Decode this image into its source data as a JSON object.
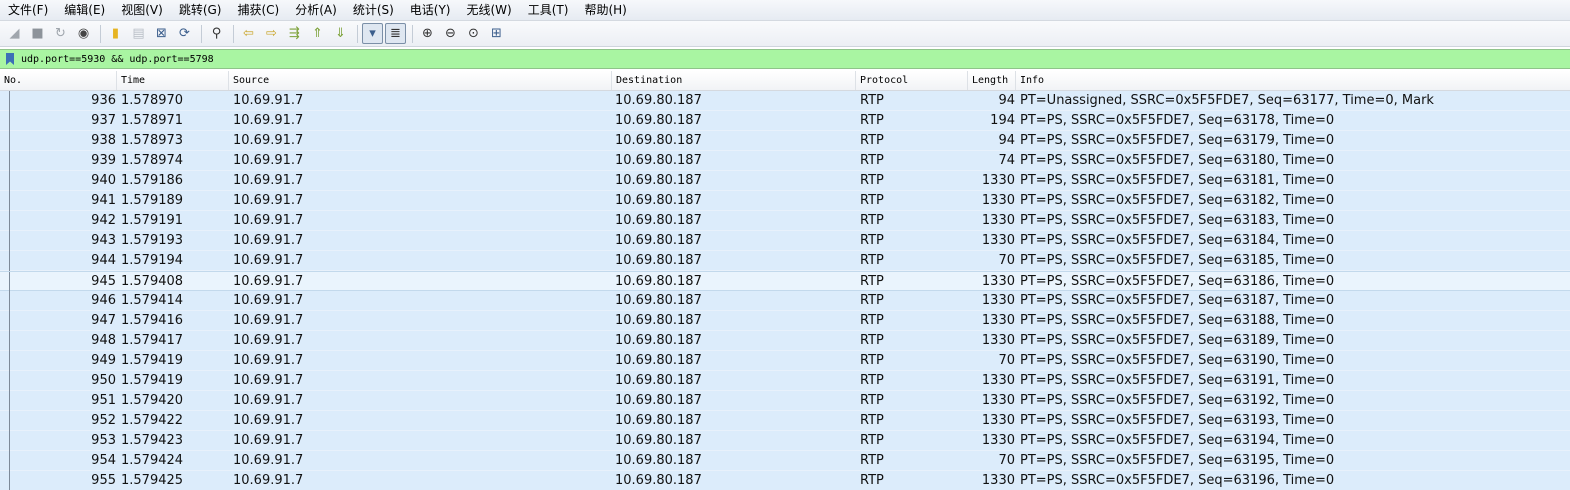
{
  "menu": [
    "文件(F)",
    "编辑(E)",
    "视图(V)",
    "跳转(G)",
    "捕获(C)",
    "分析(A)",
    "统计(S)",
    "电话(Y)",
    "无线(W)",
    "工具(T)",
    "帮助(H)"
  ],
  "toolbar": {
    "buttons": [
      {
        "name": "start-capture-icon",
        "glyph": "◢",
        "color": "#a0a6ad"
      },
      {
        "name": "stop-capture-icon",
        "glyph": "■",
        "color": "#8d939a"
      },
      {
        "name": "restart-capture-icon",
        "glyph": "↻",
        "color": "#a0a6ad"
      },
      {
        "name": "capture-options-icon",
        "glyph": "◉",
        "color": "#444444"
      },
      {
        "name": "open-file-icon",
        "glyph": "▮",
        "color": "#e6b422"
      },
      {
        "name": "save-file-icon",
        "glyph": "▤",
        "color": "#b8bec6"
      },
      {
        "name": "close-file-icon",
        "glyph": "⊠",
        "color": "#3b5e8c"
      },
      {
        "name": "reload-file-icon",
        "glyph": "⟳",
        "color": "#3b5e8c"
      },
      {
        "name": "find-packet-icon",
        "glyph": "⚲",
        "color": "#333333"
      },
      {
        "name": "go-back-icon",
        "glyph": "⇦",
        "color": "#c9a52a"
      },
      {
        "name": "go-forward-icon",
        "glyph": "⇨",
        "color": "#c9a52a"
      },
      {
        "name": "go-to-packet-icon",
        "glyph": "⇶",
        "color": "#7da23a"
      },
      {
        "name": "go-first-packet-icon",
        "glyph": "⇑",
        "color": "#7da23a"
      },
      {
        "name": "go-last-packet-icon",
        "glyph": "⇓",
        "color": "#7da23a"
      },
      {
        "name": "auto-scroll-icon",
        "glyph": "▾",
        "color": "#3b5e8c",
        "active": true
      },
      {
        "name": "colorize-icon",
        "glyph": "≣",
        "color": "#333333",
        "active": true
      },
      {
        "name": "zoom-in-icon",
        "glyph": "⊕",
        "color": "#333333"
      },
      {
        "name": "zoom-out-icon",
        "glyph": "⊖",
        "color": "#333333"
      },
      {
        "name": "zoom-normal-icon",
        "glyph": "⊙",
        "color": "#333333"
      },
      {
        "name": "resize-columns-icon",
        "glyph": "⊞",
        "color": "#3b5e8c"
      }
    ]
  },
  "filter": {
    "value": "udp.port==5930 && udp.port==5798",
    "background": "#a9f5a2"
  },
  "columns": {
    "no": "No.",
    "time": "Time",
    "source": "Source",
    "destination": "Destination",
    "protocol": "Protocol",
    "length": "Length",
    "info": "Info"
  },
  "packets": [
    {
      "no": "936",
      "time": "1.578970",
      "src": "10.69.91.7",
      "dst": "10.69.80.187",
      "proto": "RTP",
      "len": "94",
      "info": "PT=Unassigned, SSRC=0x5F5FDE7, Seq=63177, Time=0, Mark"
    },
    {
      "no": "937",
      "time": "1.578971",
      "src": "10.69.91.7",
      "dst": "10.69.80.187",
      "proto": "RTP",
      "len": "194",
      "info": "PT=PS, SSRC=0x5F5FDE7, Seq=63178, Time=0"
    },
    {
      "no": "938",
      "time": "1.578973",
      "src": "10.69.91.7",
      "dst": "10.69.80.187",
      "proto": "RTP",
      "len": "94",
      "info": "PT=PS, SSRC=0x5F5FDE7, Seq=63179, Time=0"
    },
    {
      "no": "939",
      "time": "1.578974",
      "src": "10.69.91.7",
      "dst": "10.69.80.187",
      "proto": "RTP",
      "len": "74",
      "info": "PT=PS, SSRC=0x5F5FDE7, Seq=63180, Time=0"
    },
    {
      "no": "940",
      "time": "1.579186",
      "src": "10.69.91.7",
      "dst": "10.69.80.187",
      "proto": "RTP",
      "len": "1330",
      "info": "PT=PS, SSRC=0x5F5FDE7, Seq=63181, Time=0"
    },
    {
      "no": "941",
      "time": "1.579189",
      "src": "10.69.91.7",
      "dst": "10.69.80.187",
      "proto": "RTP",
      "len": "1330",
      "info": "PT=PS, SSRC=0x5F5FDE7, Seq=63182, Time=0"
    },
    {
      "no": "942",
      "time": "1.579191",
      "src": "10.69.91.7",
      "dst": "10.69.80.187",
      "proto": "RTP",
      "len": "1330",
      "info": "PT=PS, SSRC=0x5F5FDE7, Seq=63183, Time=0"
    },
    {
      "no": "943",
      "time": "1.579193",
      "src": "10.69.91.7",
      "dst": "10.69.80.187",
      "proto": "RTP",
      "len": "1330",
      "info": "PT=PS, SSRC=0x5F5FDE7, Seq=63184, Time=0"
    },
    {
      "no": "944",
      "time": "1.579194",
      "src": "10.69.91.7",
      "dst": "10.69.80.187",
      "proto": "RTP",
      "len": "70",
      "info": "PT=PS, SSRC=0x5F5FDE7, Seq=63185, Time=0"
    },
    {
      "no": "945",
      "time": "1.579408",
      "src": "10.69.91.7",
      "dst": "10.69.80.187",
      "proto": "RTP",
      "len": "1330",
      "info": "PT=PS, SSRC=0x5F5FDE7, Seq=63186, Time=0",
      "selected": true
    },
    {
      "no": "946",
      "time": "1.579414",
      "src": "10.69.91.7",
      "dst": "10.69.80.187",
      "proto": "RTP",
      "len": "1330",
      "info": "PT=PS, SSRC=0x5F5FDE7, Seq=63187, Time=0"
    },
    {
      "no": "947",
      "time": "1.579416",
      "src": "10.69.91.7",
      "dst": "10.69.80.187",
      "proto": "RTP",
      "len": "1330",
      "info": "PT=PS, SSRC=0x5F5FDE7, Seq=63188, Time=0"
    },
    {
      "no": "948",
      "time": "1.579417",
      "src": "10.69.91.7",
      "dst": "10.69.80.187",
      "proto": "RTP",
      "len": "1330",
      "info": "PT=PS, SSRC=0x5F5FDE7, Seq=63189, Time=0"
    },
    {
      "no": "949",
      "time": "1.579419",
      "src": "10.69.91.7",
      "dst": "10.69.80.187",
      "proto": "RTP",
      "len": "70",
      "info": "PT=PS, SSRC=0x5F5FDE7, Seq=63190, Time=0"
    },
    {
      "no": "950",
      "time": "1.579419",
      "src": "10.69.91.7",
      "dst": "10.69.80.187",
      "proto": "RTP",
      "len": "1330",
      "info": "PT=PS, SSRC=0x5F5FDE7, Seq=63191, Time=0"
    },
    {
      "no": "951",
      "time": "1.579420",
      "src": "10.69.91.7",
      "dst": "10.69.80.187",
      "proto": "RTP",
      "len": "1330",
      "info": "PT=PS, SSRC=0x5F5FDE7, Seq=63192, Time=0"
    },
    {
      "no": "952",
      "time": "1.579422",
      "src": "10.69.91.7",
      "dst": "10.69.80.187",
      "proto": "RTP",
      "len": "1330",
      "info": "PT=PS, SSRC=0x5F5FDE7, Seq=63193, Time=0"
    },
    {
      "no": "953",
      "time": "1.579423",
      "src": "10.69.91.7",
      "dst": "10.69.80.187",
      "proto": "RTP",
      "len": "1330",
      "info": "PT=PS, SSRC=0x5F5FDE7, Seq=63194, Time=0"
    },
    {
      "no": "954",
      "time": "1.579424",
      "src": "10.69.91.7",
      "dst": "10.69.80.187",
      "proto": "RTP",
      "len": "70",
      "info": "PT=PS, SSRC=0x5F5FDE7, Seq=63195, Time=0"
    },
    {
      "no": "955",
      "time": "1.579425",
      "src": "10.69.91.7",
      "dst": "10.69.80.187",
      "proto": "RTP",
      "len": "1330",
      "info": "PT=PS, SSRC=0x5F5FDE7, Seq=63196, Time=0"
    }
  ],
  "colors": {
    "row_background": "#dcecfb",
    "selected_row_background": "#eaf4fd",
    "filter_valid_background": "#a9f5a2"
  }
}
